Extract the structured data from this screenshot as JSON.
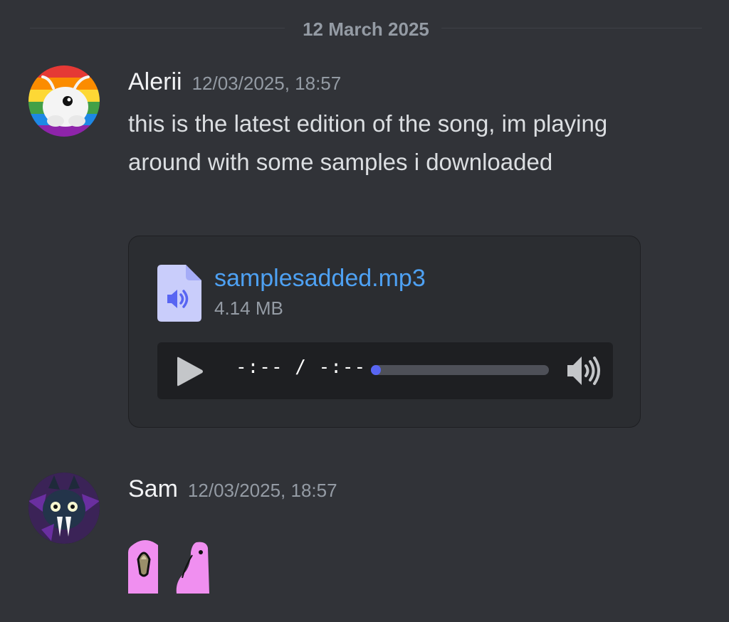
{
  "date_divider": "12 March 2025",
  "messages": [
    {
      "username": "Alerii",
      "timestamp": "12/03/2025, 18:57",
      "avatar": "rainbow-axolotl-avatar",
      "text": "this is the latest edition of the song, im playing around with some samples i downloaded",
      "attachment": {
        "file_name": "samplesadded.mp3",
        "file_size": "4.14 MB",
        "file_icon": "audio-file-icon",
        "player": {
          "time": "-:-- / -:--",
          "progress": 0,
          "play_icon": "play-icon",
          "volume_icon": "volume-icon"
        }
      }
    },
    {
      "username": "Sam",
      "timestamp": "12/03/2025, 18:57",
      "avatar": "purple-bat-avatar",
      "emojis": [
        "party-parrot-emoji",
        "party-parrot-emoji"
      ]
    }
  ],
  "colors": {
    "background": "#313338",
    "link": "#4ea1f3",
    "accent": "#5865f2",
    "muted": "#949ba4",
    "parrot": "#f08ff0"
  }
}
